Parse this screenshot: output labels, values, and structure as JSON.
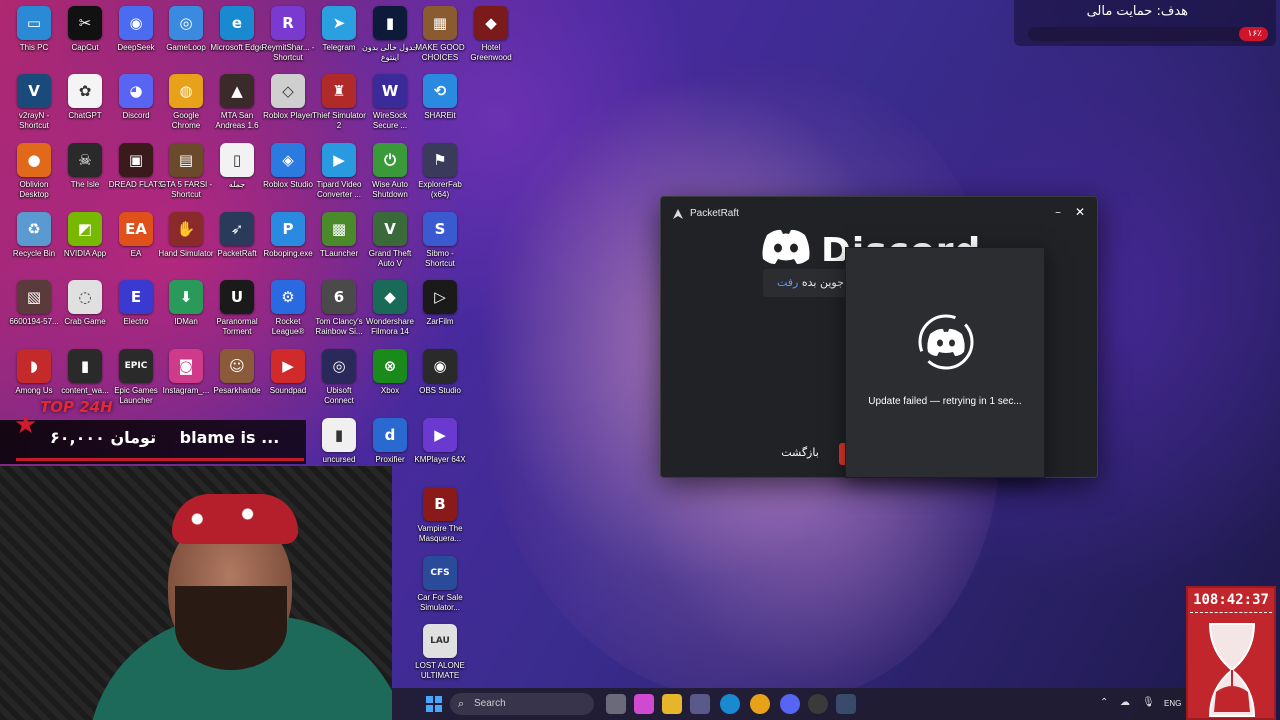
{
  "desktop": {
    "icons": [
      {
        "label": "This PC",
        "color": "#2b8ad6",
        "glyph": "▭"
      },
      {
        "label": "CapCut",
        "color": "#111111",
        "glyph": "✂"
      },
      {
        "label": "DeepSeek",
        "color": "#4a6cf0",
        "glyph": "◉"
      },
      {
        "label": "GameLoop",
        "color": "#3a8ae0",
        "glyph": "◎"
      },
      {
        "label": "Microsoft Edge",
        "color": "#1a8ad0",
        "glyph": "e"
      },
      {
        "label": "ReymitShar... - Shortcut",
        "color": "#7a3ad0",
        "glyph": "R"
      },
      {
        "label": "Telegram",
        "color": "#2aa0e0",
        "glyph": "➤"
      },
      {
        "label": "جدول خالی بدون اینتوع",
        "color": "#0e1a3a",
        "glyph": "▮"
      },
      {
        "label": "MAKE GOOD CHOICES",
        "color": "#8a5a30",
        "glyph": "▦"
      },
      {
        "label": "Hotel Greenwood",
        "color": "#7a1a1a",
        "glyph": "◆"
      },
      {
        "label": "v2rayN - Shortcut",
        "color": "#1a4a7a",
        "glyph": "V"
      },
      {
        "label": "ChatGPT",
        "color": "#f4f4f4",
        "glyph": "✿"
      },
      {
        "label": "Discord",
        "color": "#5865f2",
        "glyph": "◕"
      },
      {
        "label": "Google Chrome",
        "color": "#e8a21a",
        "glyph": "◍"
      },
      {
        "label": "MTA San Andreas 1.6",
        "color": "#3a2a2a",
        "glyph": "▲"
      },
      {
        "label": "Roblox Player",
        "color": "#cfcfcf",
        "glyph": "◇"
      },
      {
        "label": "Thief Simulator 2",
        "color": "#b02a2a",
        "glyph": "♜"
      },
      {
        "label": "WireSock Secure ...",
        "color": "#3a2a9a",
        "glyph": "W"
      },
      {
        "label": "SHAREit",
        "color": "#2a8ae0",
        "glyph": "⟲"
      },
      {
        "label": "Oblivion Desktop",
        "color": "#e06a1a",
        "glyph": "●"
      },
      {
        "label": "The Isle",
        "color": "#2a2a2a",
        "glyph": "☠"
      },
      {
        "label": "DREAD FLATS",
        "color": "#3a1a1a",
        "glyph": "▣"
      },
      {
        "label": "GTA 5 FARSI - Shortcut",
        "color": "#6a4a2a",
        "glyph": "▤"
      },
      {
        "label": "جمله",
        "color": "#f2f2f2",
        "glyph": "▯"
      },
      {
        "label": "Roblox Studio",
        "color": "#2a7ae0",
        "glyph": "◈"
      },
      {
        "label": "Tipard Video Converter ...",
        "color": "#2a9ae0",
        "glyph": "▶"
      },
      {
        "label": "Wise Auto Shutdown",
        "color": "#3a9a3a",
        "glyph": "⏻"
      },
      {
        "label": "ExplorerFab (x64)",
        "color": "#3a3a5a",
        "glyph": "⚑"
      },
      {
        "label": "Recycle Bin",
        "color": "#5a9ad0",
        "glyph": "♻"
      },
      {
        "label": "NVIDIA App",
        "color": "#76b900",
        "glyph": "◩"
      },
      {
        "label": "EA",
        "color": "#e0501a",
        "glyph": "EA"
      },
      {
        "label": "Hand Simulator",
        "color": "#8a2a2a",
        "glyph": "✋"
      },
      {
        "label": "PacketRaft",
        "color": "#2a3a5a",
        "glyph": "➶"
      },
      {
        "label": "Roboping.exe",
        "color": "#2a8ae0",
        "glyph": "P"
      },
      {
        "label": "TLauncher",
        "color": "#4a8a2a",
        "glyph": "▩"
      },
      {
        "label": "Grand Theft Auto V",
        "color": "#3a6a3a",
        "glyph": "V"
      },
      {
        "label": "Sibmo - Shortcut",
        "color": "#3a5ad0",
        "glyph": "S"
      },
      {
        "label": "6600194-57...",
        "color": "#5a3a3a",
        "glyph": "▧"
      },
      {
        "label": "Crab Game",
        "color": "#e0e0e0",
        "glyph": "◌"
      },
      {
        "label": "Electro",
        "color": "#3a3ad0",
        "glyph": "E"
      },
      {
        "label": "IDMan",
        "color": "#2a9a5a",
        "glyph": "⬇"
      },
      {
        "label": "Paranormal Torment",
        "color": "#1a1a1a",
        "glyph": "U"
      },
      {
        "label": "Rocket League®",
        "color": "#2a6ae0",
        "glyph": "⚙"
      },
      {
        "label": "Tom Clancy's Rainbow Si...",
        "color": "#4a4a4a",
        "glyph": "6"
      },
      {
        "label": "Wondershare Filmora 14",
        "color": "#1a6a5a",
        "glyph": "◆"
      },
      {
        "label": "ZarFilm",
        "color": "#1a1a1a",
        "glyph": "▷"
      },
      {
        "label": "Among Us",
        "color": "#c42a2a",
        "glyph": "◗"
      },
      {
        "label": "content_wa...",
        "color": "#2a2a2a",
        "glyph": "▮"
      },
      {
        "label": "Epic Games Launcher",
        "color": "#2a2a2a",
        "glyph": "EPIC"
      },
      {
        "label": "Instagram_...",
        "color": "#d03a8a",
        "glyph": "◙"
      },
      {
        "label": "Pesarkhande",
        "color": "#8a5a3a",
        "glyph": "☺"
      },
      {
        "label": "Soundpad",
        "color": "#d02a2a",
        "glyph": "▶"
      },
      {
        "label": "Ubisoft Connect",
        "color": "#2a2a5a",
        "glyph": "◎"
      },
      {
        "label": "Xbox",
        "color": "#1a8a1a",
        "glyph": "⊗"
      },
      {
        "label": "OBS Studio",
        "color": "#2a2a2a",
        "glyph": "◉"
      },
      {
        "label": "uncursed",
        "color": "#f0f0f0",
        "glyph": "▮"
      },
      {
        "label": "Proxifier",
        "color": "#2a6ad0",
        "glyph": "d"
      },
      {
        "label": "KMPlayer 64X",
        "color": "#6a3ad0",
        "glyph": "▶"
      },
      {
        "label": "Vampire The Masquera...",
        "color": "#8a1a1a",
        "glyph": "B"
      },
      {
        "label": "Car For Sale Simulator...",
        "color": "#2a4a9a",
        "glyph": "CFS"
      },
      {
        "label": "LOST ALONE ULTIMATE",
        "color": "#e0e0e0",
        "glyph": "LAU"
      }
    ]
  },
  "goal": {
    "title": "هدف: حمایت مالی",
    "percent_label": "۱۶٪",
    "percent": 0.12,
    "color": "#d0142a"
  },
  "packetraft": {
    "title": "PacketRaft",
    "discord_word": "Discord",
    "join_link": "رفت",
    "join_text": "جوین بده",
    "back_label": "بازگشت"
  },
  "update_dialog": {
    "message": "Update failed — retrying in 1 sec..."
  },
  "donation": {
    "badge": "TOP 24H",
    "amount": "۶۰,۰۰۰ تومان",
    "name": "blame is ..."
  },
  "taskbar": {
    "search_placeholder": "Search",
    "lang": "ENG"
  },
  "timer": {
    "value": "108:42:37"
  },
  "colors": {
    "discord": "#5865f2",
    "accent_red": "#c1262d"
  }
}
